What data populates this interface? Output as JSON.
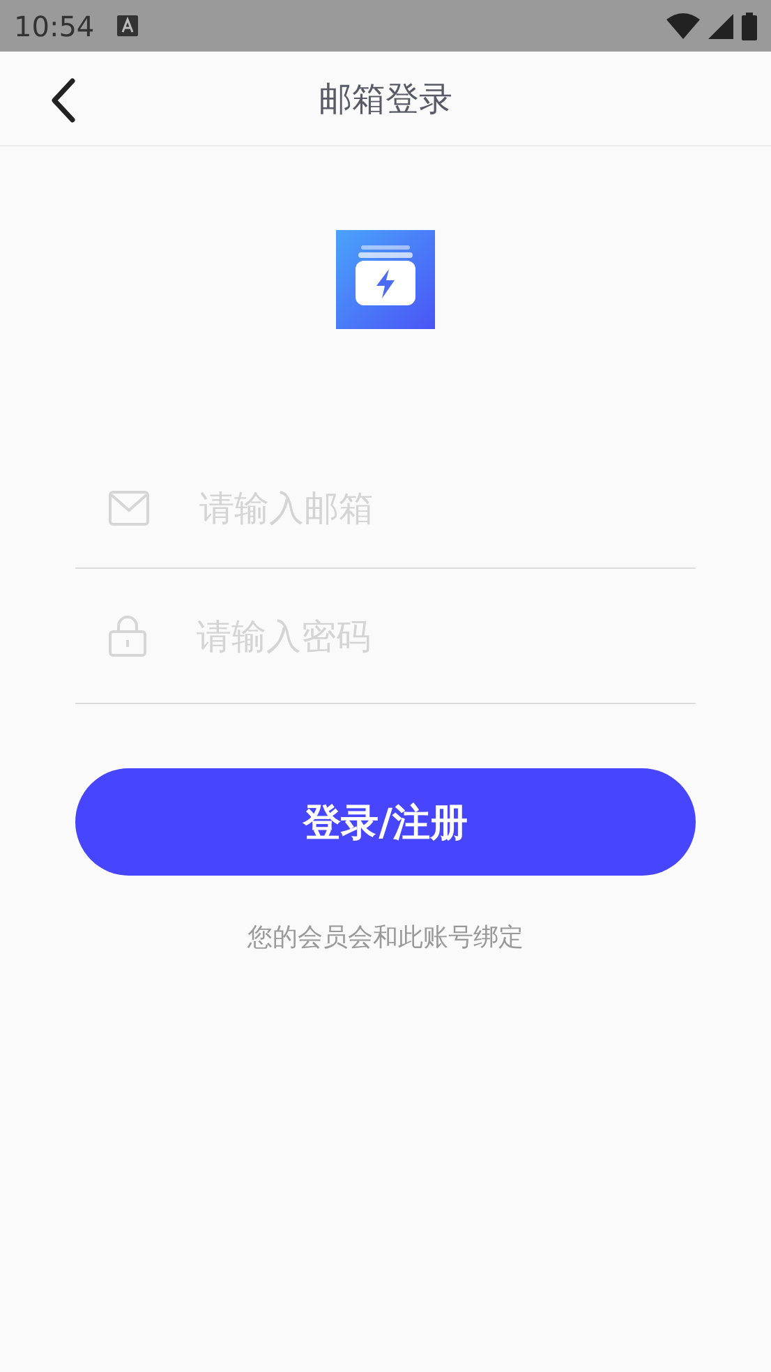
{
  "status_bar": {
    "time": "10:54"
  },
  "header": {
    "title": "邮箱登录"
  },
  "fields": [
    {
      "kind": "email",
      "placeholder": "请输入邮箱"
    },
    {
      "kind": "password",
      "placeholder": "请输入密码"
    }
  ],
  "submit_button": "登录/注册",
  "note": "您的会员会和此账号绑定"
}
